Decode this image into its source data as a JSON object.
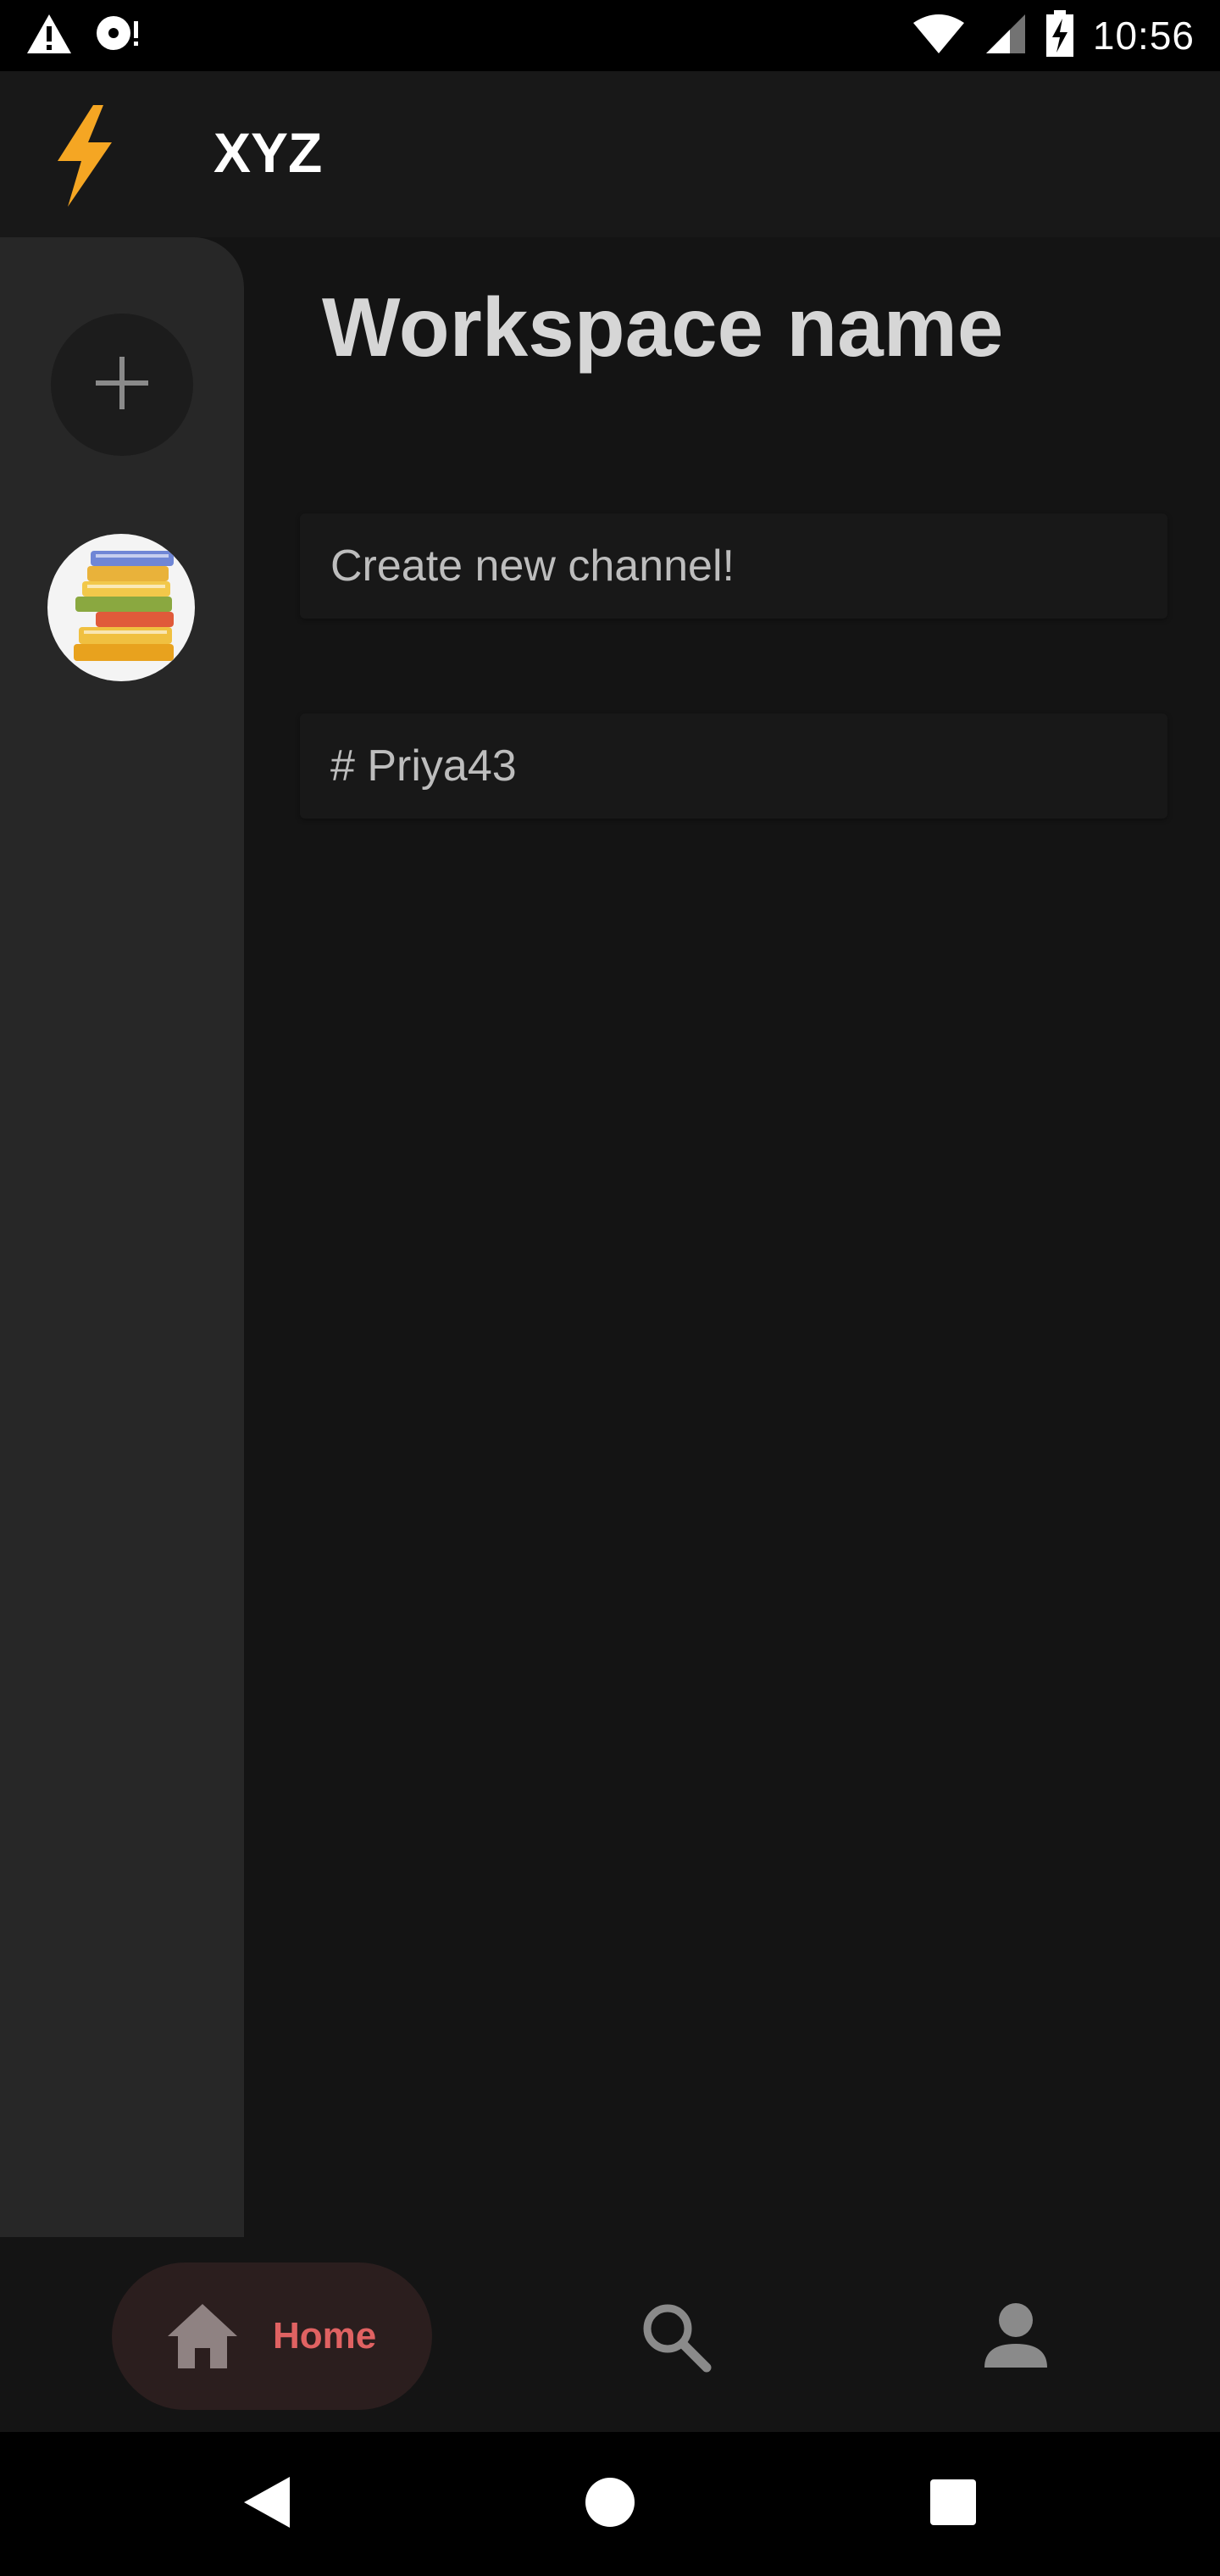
{
  "status_bar": {
    "time": "10:56",
    "left_icons": [
      "warning-icon",
      "media-notification-icon"
    ],
    "right_icons": [
      "wifi-icon",
      "signal-icon",
      "battery-charging-icon"
    ]
  },
  "app_bar": {
    "logo_icon": "lightning-bolt-icon",
    "title": "XYZ"
  },
  "workspace_rail": {
    "add_icon": "plus-icon",
    "workspaces": [
      {
        "avatar_icon": "books-stack-icon"
      }
    ]
  },
  "main": {
    "workspace_name": "Workspace name",
    "create_channel_label": "Create new channel!",
    "channels": [
      {
        "label": "# Priya43"
      }
    ]
  },
  "bottom_nav": {
    "items": [
      {
        "label": "Home",
        "icon": "home-icon",
        "active": true
      },
      {
        "icon": "search-icon",
        "active": false
      },
      {
        "icon": "profile-icon",
        "active": false
      }
    ]
  },
  "system_nav": {
    "buttons": [
      "back-icon",
      "home-circle-icon",
      "recents-icon"
    ]
  },
  "colors": {
    "background": "#141414",
    "rail": "#272727",
    "accent": "#e06262",
    "bolt": "#f5a623"
  }
}
